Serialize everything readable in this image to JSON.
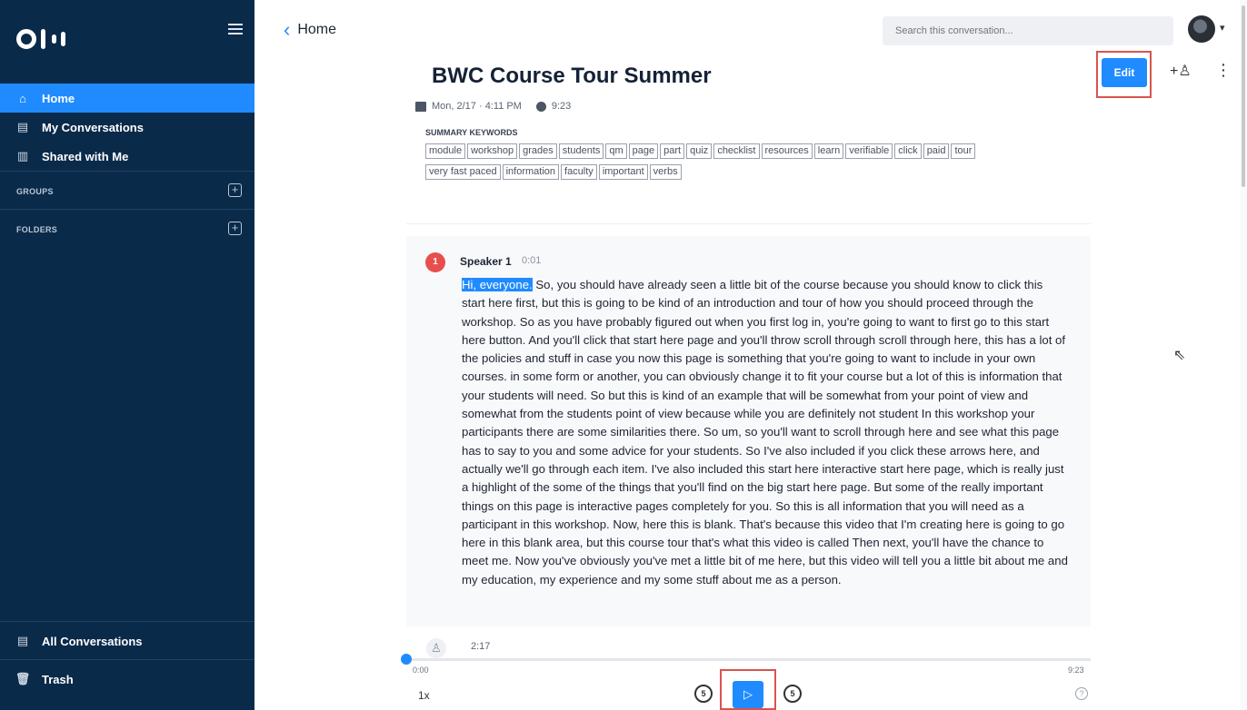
{
  "sidebar": {
    "nav": [
      {
        "label": "Home",
        "icon": "home-icon"
      },
      {
        "label": "My Conversations",
        "icon": "conversations-icon"
      },
      {
        "label": "Shared with Me",
        "icon": "shared-icon"
      }
    ],
    "groups_label": "GROUPS",
    "folders_label": "FOLDERS",
    "bottom": [
      {
        "label": "All Conversations",
        "icon": "all-conversations-icon"
      },
      {
        "label": "Trash",
        "icon": "trash-icon"
      }
    ]
  },
  "header": {
    "back_label": "Home",
    "search_placeholder": "Search this conversation..."
  },
  "conversation": {
    "title": "BWC Course Tour Summer",
    "date": "Mon, 2/17 · 4:11 PM",
    "duration": "9:23",
    "edit_label": "Edit",
    "keywords_label": "SUMMARY KEYWORDS",
    "keywords_row1": [
      "module",
      "workshop",
      "grades",
      "students",
      "qm",
      "page",
      "part",
      "quiz",
      "checklist",
      "resources",
      "learn",
      "verifiable",
      "click",
      "paid",
      "tour"
    ],
    "keywords_row2": [
      "very fast paced",
      "information",
      "faculty",
      "important",
      "verbs"
    ]
  },
  "transcript": {
    "speaker_number": "1",
    "speaker_name": "Speaker 1",
    "speaker_time": "0:01",
    "highlight": "Hi, everyone.",
    "text": " So, you should have already seen a little bit of the course because you should know to click this start here first, but this is going to be kind of an introduction and tour of how you should proceed through the workshop. So as you have probably figured out when you first log in, you're going to want to first go to this start here button. And you'll click that start here page and you'll throw scroll through scroll through here, this has a lot of the policies and stuff in case you now this page is something that you're going to want to include in your own courses. in some form or another, you can obviously change it to fit your course but a lot of this is information that your students will need. So but this is kind of an example that will be somewhat from your point of view and somewhat from the students point of view because while you are definitely not student In this workshop your participants there are some similarities there. So um, so you'll want to scroll through here and see what this page has to say to you and some advice for your students. So I've also included if you click these arrows here, and actually we'll go through each item. I've also included this start here interactive start here page, which is really just a highlight of the some of the things that you'll find on the big start here page. But some of the really important things on this page is interactive pages completely for you. So this is all information that you will need as a participant in this workshop. Now, here this is blank. That's because this video that I'm creating here is going to go here in this blank area, but this course tour that's what this video is called Then next, you'll have the chance to meet me. Now you've obviously you've met a little bit of me here, but this video will tell you a little bit about me and my education, my experience and my some stuff about me as a person.",
    "next_speaker_time": "2:17"
  },
  "player": {
    "current": "0:00",
    "total": "9:23",
    "speed": "1x",
    "rewind_label": "5",
    "forward_label": "5",
    "progress": 0.0
  },
  "colors": {
    "sidebar": "#0a2a4a",
    "accent": "#1f8bff",
    "speaker1": "#e94e4e",
    "highlight_box": "#d9534f"
  }
}
